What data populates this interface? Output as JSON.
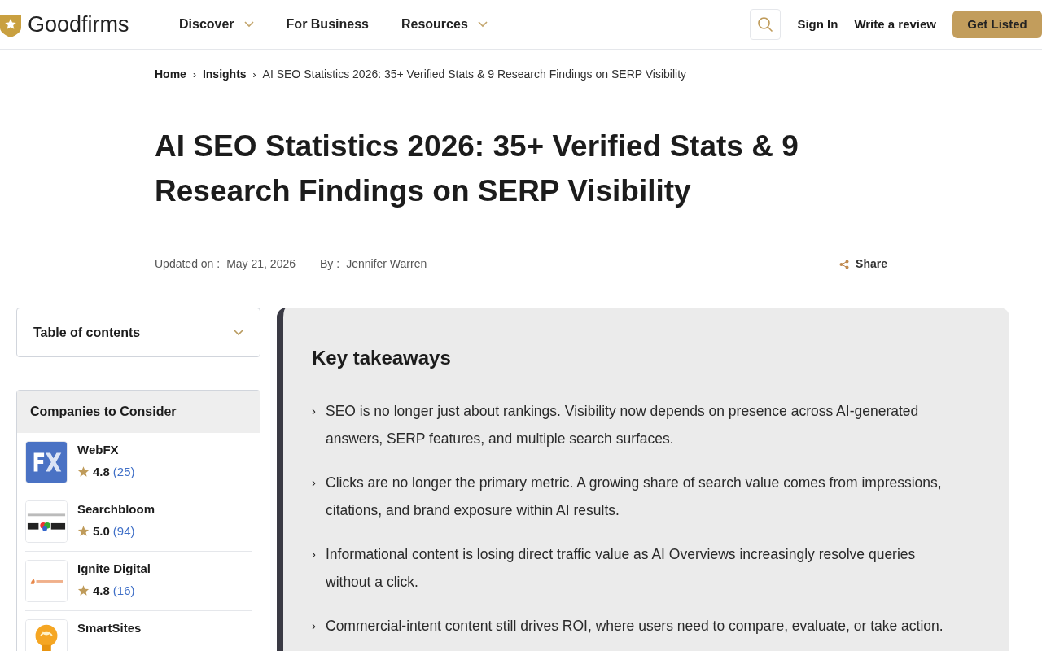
{
  "header": {
    "brand": "Goodfirms",
    "nav": [
      {
        "label": "Discover",
        "dropdown": true
      },
      {
        "label": "For Business",
        "dropdown": false
      },
      {
        "label": "Resources",
        "dropdown": true
      }
    ],
    "sign_in": "Sign In",
    "write_review": "Write a review",
    "cta": "Get Listed"
  },
  "breadcrumb_separator": "›",
  "breadcrumb": [
    "Home",
    "Insights",
    "AI SEO Statistics 2026: 35+ Verified Stats & 9 Research Findings on SERP Visibility"
  ],
  "title": "AI SEO Statistics 2026: 35+ Verified Stats & 9 Research Findings on SERP Visibility",
  "meta": {
    "updated_label": "Updated on :",
    "updated": "May 21, 2026",
    "by_label": "By :",
    "author": "Jennifer Warren",
    "share": "Share"
  },
  "toc": {
    "label": "Table of contents",
    "expanded": false
  },
  "companies": {
    "title": "Companies to Consider",
    "items": [
      {
        "name": "WebFX",
        "rating": "4.8",
        "reviews": "(25)",
        "kind": "fx"
      },
      {
        "name": "Searchbloom",
        "rating": "5.0",
        "reviews": "(94)",
        "kind": "searchbloom"
      },
      {
        "name": "Ignite Digital",
        "rating": "4.8",
        "reviews": "(16)",
        "kind": "ignite"
      },
      {
        "name": "SmartSites",
        "kind": "bulb"
      }
    ]
  },
  "takeaways": {
    "title": "Key takeaways",
    "bullet": "›",
    "items": [
      "SEO is no longer just about rankings. Visibility now depends on presence across AI-generated answers, SERP features, and multiple search surfaces.",
      "Clicks are no longer the primary metric. A growing share of search value comes from impressions, citations, and brand exposure within AI results.",
      "Informational content is losing direct traffic value as AI Overviews increasingly resolve queries without a click.",
      "Commercial-intent content still drives ROI, where users need to compare, evaluate, or take action."
    ]
  }
}
